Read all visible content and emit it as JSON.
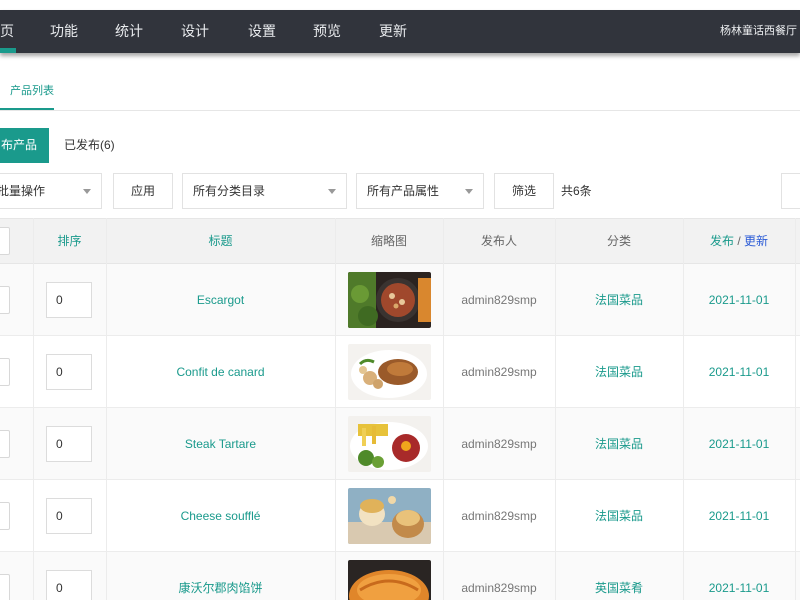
{
  "nav": {
    "items": [
      "页",
      "功能",
      "统计",
      "设计",
      "设置",
      "预览",
      "更新"
    ],
    "site_name": "杨林童话西餐厅"
  },
  "subtab": {
    "label": "产品列表"
  },
  "status_tabs": {
    "active_label": "布产品",
    "published_label": "已发布(6)"
  },
  "filters": {
    "bulk_action": "批量操作",
    "apply_label": "应用",
    "category": "所有分类目录",
    "attribute": "所有产品属性",
    "filter_label": "筛选",
    "count_text": "共6条"
  },
  "table": {
    "headers": {
      "sort": "排序",
      "title": "标题",
      "thumbnail": "缩略图",
      "publisher": "发布人",
      "category": "分类",
      "publish": "发布",
      "separator": " / ",
      "update": "更新"
    },
    "rows": [
      {
        "sort": "0",
        "title": "Escargot",
        "publisher": "admin829smp",
        "category": "法国菜品",
        "date": "2021-11-01",
        "thumb": "escargot-photo"
      },
      {
        "sort": "0",
        "title": "Confit de canard",
        "publisher": "admin829smp",
        "category": "法国菜品",
        "date": "2021-11-01",
        "thumb": "duck-confit-photo"
      },
      {
        "sort": "0",
        "title": "Steak Tartare",
        "publisher": "admin829smp",
        "category": "法国菜品",
        "date": "2021-11-01",
        "thumb": "steak-tartare-photo"
      },
      {
        "sort": "0",
        "title": "Cheese soufflé",
        "publisher": "admin829smp",
        "category": "法国菜品",
        "date": "2021-11-01",
        "thumb": "cheese-souffle-photo"
      },
      {
        "sort": "0",
        "title": "康沃尔郡肉馅饼",
        "publisher": "admin829smp",
        "category": "英国菜肴",
        "date": "2021-11-01",
        "thumb": "cornish-pasty-photo"
      }
    ]
  },
  "colors": {
    "accent": "#1a9a8c",
    "nav_bg": "#31343c",
    "link_blue": "#2a5ad6"
  }
}
